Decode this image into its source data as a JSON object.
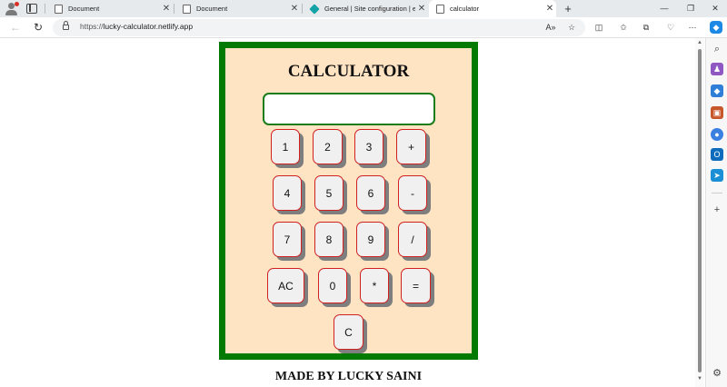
{
  "browser": {
    "tabs": [
      {
        "label": "Document",
        "icon": "document-icon"
      },
      {
        "label": "Document",
        "icon": "document-icon"
      },
      {
        "label": "General | Site configuration | effi",
        "icon": "netlify-icon"
      },
      {
        "label": "calculator",
        "icon": "document-icon",
        "active": true
      }
    ],
    "new_tab_label": "+",
    "url_scheme": "https://",
    "url_host": "lucky-calculator.netlify.app",
    "controls": {
      "minimize": "—",
      "restore": "❐",
      "close": "✕"
    }
  },
  "calculator": {
    "title": "CALCULATOR",
    "display_value": "",
    "keys": {
      "k1": "1",
      "k2": "2",
      "k3": "3",
      "plus": "+",
      "k4": "4",
      "k5": "5",
      "k6": "6",
      "minus": "-",
      "k7": "7",
      "k8": "8",
      "k9": "9",
      "divide": "/",
      "ac": "AC",
      "k0": "0",
      "multiply": "*",
      "equals": "=",
      "clear": "C"
    },
    "colors": {
      "panel": "#ffe4c4",
      "border": "#037a03",
      "key_border": "#d12020",
      "key_shadow": "#7e7e7e"
    }
  },
  "footer": {
    "text": "MADE BY LUCKY SAINI"
  }
}
